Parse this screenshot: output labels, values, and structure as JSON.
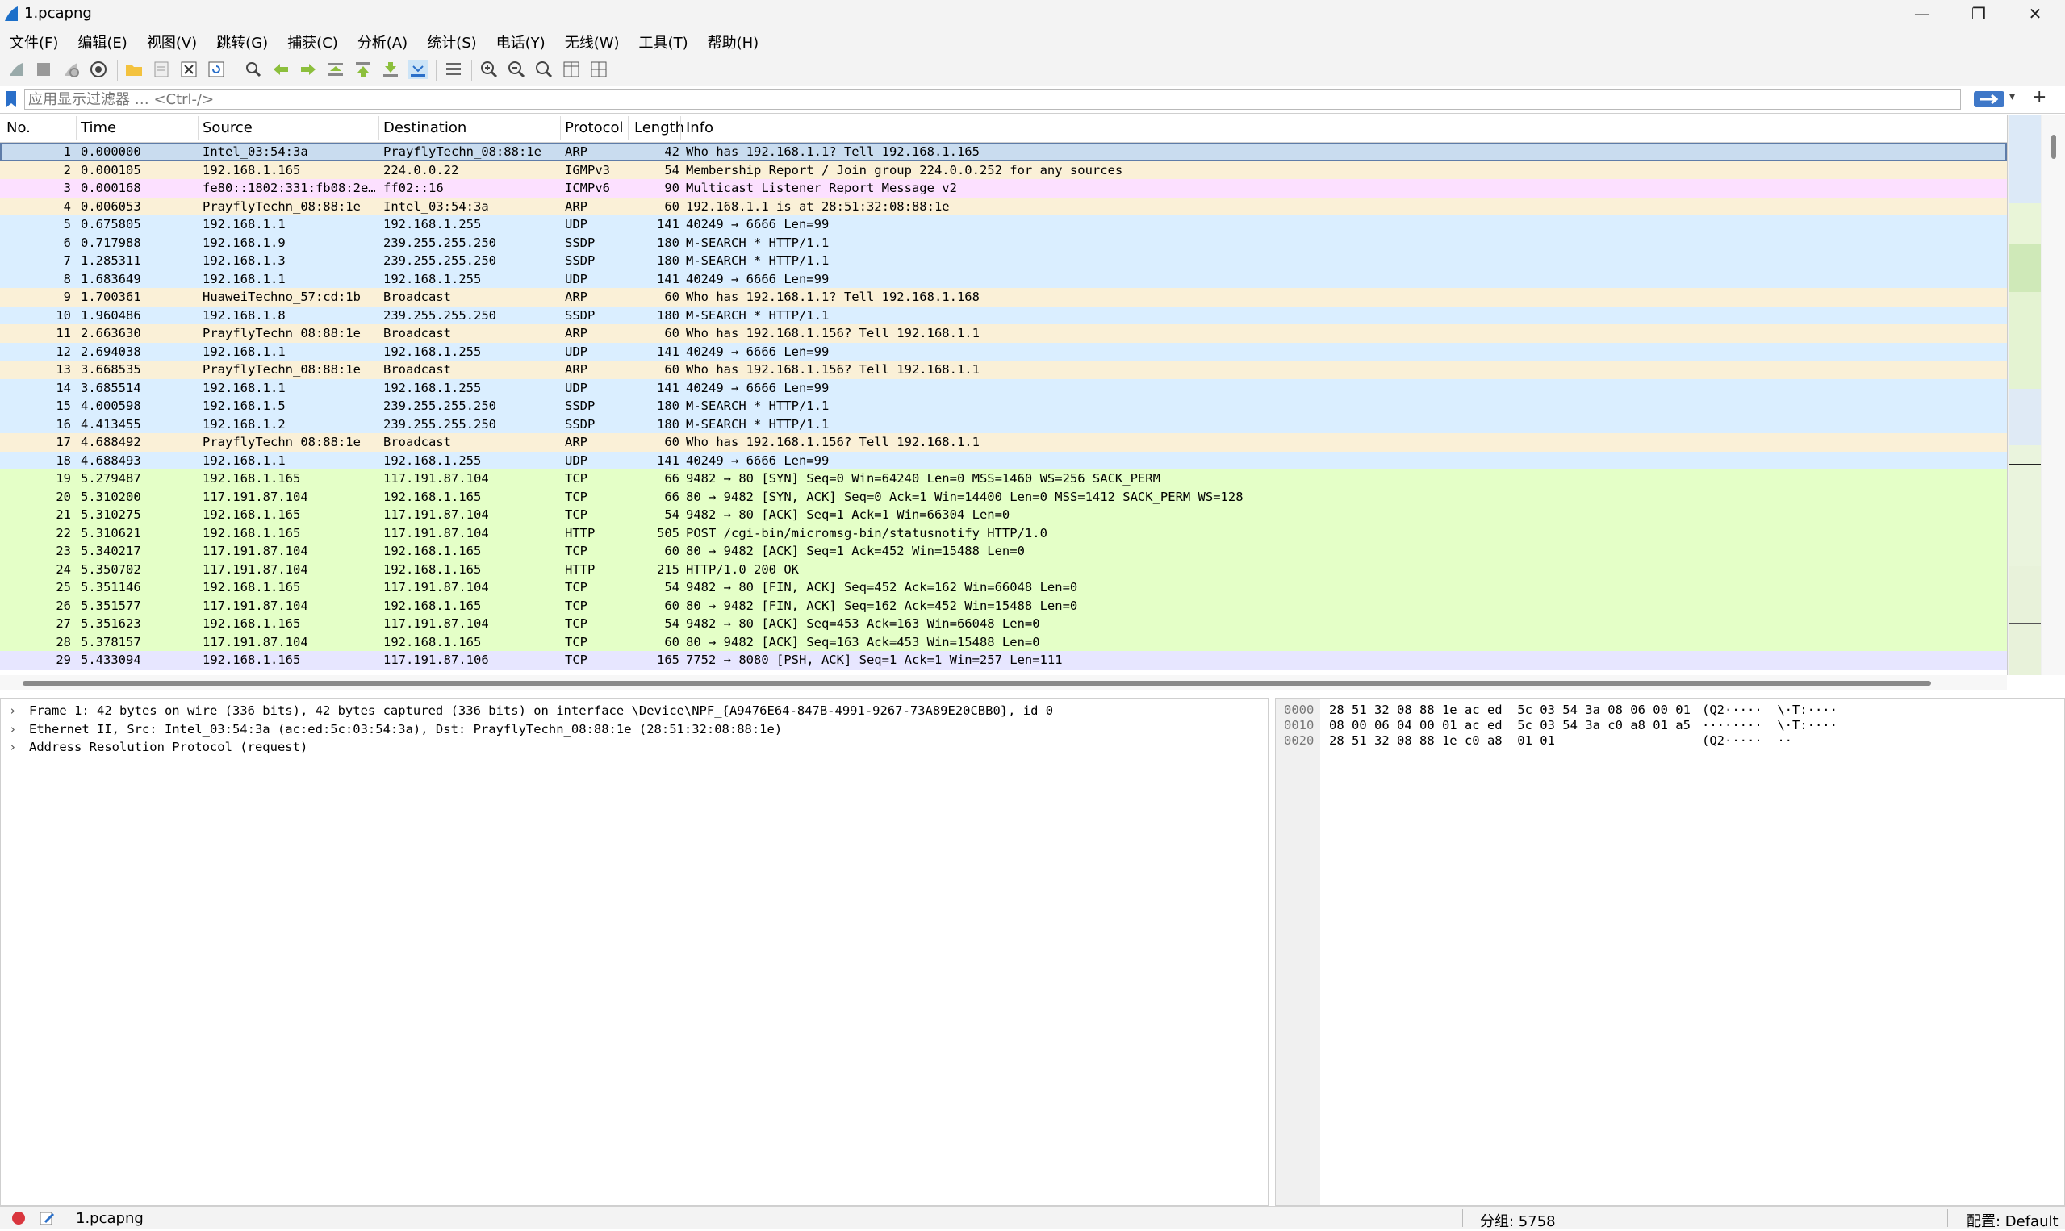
{
  "window": {
    "title": "1.pcapng"
  },
  "menu": [
    "文件(F)",
    "编辑(E)",
    "视图(V)",
    "跳转(G)",
    "捕获(C)",
    "分析(A)",
    "统计(S)",
    "电话(Y)",
    "无线(W)",
    "工具(T)",
    "帮助(H)"
  ],
  "filter": {
    "placeholder": "应用显示过滤器 … <Ctrl-/>",
    "value": ""
  },
  "columns": [
    "No.",
    "Time",
    "Source",
    "Destination",
    "Protocol",
    "Length",
    "Info"
  ],
  "colors": {
    "arp": "#faf0d7",
    "udp": "#daeeff",
    "icmpv6": "#fce0ff",
    "tcp": "#e7e6ff",
    "http": "#e4ffc7",
    "selected_border": "#5e7ca8"
  },
  "packets": [
    {
      "no": "1",
      "time": "0.000000",
      "src": "Intel_03:54:3a",
      "dst": "PrayflyTechn_08:88:1e",
      "proto": "ARP",
      "len": "42",
      "info": "Who has 192.168.1.1? Tell 192.168.1.165",
      "color": "arp-sel"
    },
    {
      "no": "2",
      "time": "0.000105",
      "src": "192.168.1.165",
      "dst": "224.0.0.22",
      "proto": "IGMPv3",
      "len": "54",
      "info": "Membership Report / Join group 224.0.0.252 for any sources",
      "color": "arp"
    },
    {
      "no": "3",
      "time": "0.000168",
      "src": "fe80::1802:331:fb08:2e…",
      "dst": "ff02::16",
      "proto": "ICMPv6",
      "len": "90",
      "info": "Multicast Listener Report Message v2",
      "color": "icmpv6"
    },
    {
      "no": "4",
      "time": "0.006053",
      "src": "PrayflyTechn_08:88:1e",
      "dst": "Intel_03:54:3a",
      "proto": "ARP",
      "len": "60",
      "info": "192.168.1.1 is at 28:51:32:08:88:1e",
      "color": "arp"
    },
    {
      "no": "5",
      "time": "0.675805",
      "src": "192.168.1.1",
      "dst": "192.168.1.255",
      "proto": "UDP",
      "len": "141",
      "info": "40249 → 6666 Len=99",
      "color": "udp"
    },
    {
      "no": "6",
      "time": "0.717988",
      "src": "192.168.1.9",
      "dst": "239.255.255.250",
      "proto": "SSDP",
      "len": "180",
      "info": "M-SEARCH * HTTP/1.1",
      "color": "udp"
    },
    {
      "no": "7",
      "time": "1.285311",
      "src": "192.168.1.3",
      "dst": "239.255.255.250",
      "proto": "SSDP",
      "len": "180",
      "info": "M-SEARCH * HTTP/1.1",
      "color": "udp"
    },
    {
      "no": "8",
      "time": "1.683649",
      "src": "192.168.1.1",
      "dst": "192.168.1.255",
      "proto": "UDP",
      "len": "141",
      "info": "40249 → 6666 Len=99",
      "color": "udp"
    },
    {
      "no": "9",
      "time": "1.700361",
      "src": "HuaweiTechno_57:cd:1b",
      "dst": "Broadcast",
      "proto": "ARP",
      "len": "60",
      "info": "Who has 192.168.1.1? Tell 192.168.1.168",
      "color": "arp"
    },
    {
      "no": "10",
      "time": "1.960486",
      "src": "192.168.1.8",
      "dst": "239.255.255.250",
      "proto": "SSDP",
      "len": "180",
      "info": "M-SEARCH * HTTP/1.1",
      "color": "udp"
    },
    {
      "no": "11",
      "time": "2.663630",
      "src": "PrayflyTechn_08:88:1e",
      "dst": "Broadcast",
      "proto": "ARP",
      "len": "60",
      "info": "Who has 192.168.1.156? Tell 192.168.1.1",
      "color": "arp"
    },
    {
      "no": "12",
      "time": "2.694038",
      "src": "192.168.1.1",
      "dst": "192.168.1.255",
      "proto": "UDP",
      "len": "141",
      "info": "40249 → 6666 Len=99",
      "color": "udp"
    },
    {
      "no": "13",
      "time": "3.668535",
      "src": "PrayflyTechn_08:88:1e",
      "dst": "Broadcast",
      "proto": "ARP",
      "len": "60",
      "info": "Who has 192.168.1.156? Tell 192.168.1.1",
      "color": "arp"
    },
    {
      "no": "14",
      "time": "3.685514",
      "src": "192.168.1.1",
      "dst": "192.168.1.255",
      "proto": "UDP",
      "len": "141",
      "info": "40249 → 6666 Len=99",
      "color": "udp"
    },
    {
      "no": "15",
      "time": "4.000598",
      "src": "192.168.1.5",
      "dst": "239.255.255.250",
      "proto": "SSDP",
      "len": "180",
      "info": "M-SEARCH * HTTP/1.1",
      "color": "udp"
    },
    {
      "no": "16",
      "time": "4.413455",
      "src": "192.168.1.2",
      "dst": "239.255.255.250",
      "proto": "SSDP",
      "len": "180",
      "info": "M-SEARCH * HTTP/1.1",
      "color": "udp"
    },
    {
      "no": "17",
      "time": "4.688492",
      "src": "PrayflyTechn_08:88:1e",
      "dst": "Broadcast",
      "proto": "ARP",
      "len": "60",
      "info": "Who has 192.168.1.156? Tell 192.168.1.1",
      "color": "arp"
    },
    {
      "no": "18",
      "time": "4.688493",
      "src": "192.168.1.1",
      "dst": "192.168.1.255",
      "proto": "UDP",
      "len": "141",
      "info": "40249 → 6666 Len=99",
      "color": "udp"
    },
    {
      "no": "19",
      "time": "5.279487",
      "src": "192.168.1.165",
      "dst": "117.191.87.104",
      "proto": "TCP",
      "len": "66",
      "info": "9482 → 80 [SYN] Seq=0 Win=64240 Len=0 MSS=1460 WS=256 SACK_PERM",
      "color": "http"
    },
    {
      "no": "20",
      "time": "5.310200",
      "src": "117.191.87.104",
      "dst": "192.168.1.165",
      "proto": "TCP",
      "len": "66",
      "info": "80 → 9482 [SYN, ACK] Seq=0 Ack=1 Win=14400 Len=0 MSS=1412 SACK_PERM WS=128",
      "color": "http"
    },
    {
      "no": "21",
      "time": "5.310275",
      "src": "192.168.1.165",
      "dst": "117.191.87.104",
      "proto": "TCP",
      "len": "54",
      "info": "9482 → 80 [ACK] Seq=1 Ack=1 Win=66304 Len=0",
      "color": "http"
    },
    {
      "no": "22",
      "time": "5.310621",
      "src": "192.168.1.165",
      "dst": "117.191.87.104",
      "proto": "HTTP",
      "len": "505",
      "info": "POST /cgi-bin/micromsg-bin/statusnotify HTTP/1.0",
      "color": "http"
    },
    {
      "no": "23",
      "time": "5.340217",
      "src": "117.191.87.104",
      "dst": "192.168.1.165",
      "proto": "TCP",
      "len": "60",
      "info": "80 → 9482 [ACK] Seq=1 Ack=452 Win=15488 Len=0",
      "color": "http"
    },
    {
      "no": "24",
      "time": "5.350702",
      "src": "117.191.87.104",
      "dst": "192.168.1.165",
      "proto": "HTTP",
      "len": "215",
      "info": "HTTP/1.0 200 OK",
      "color": "http"
    },
    {
      "no": "25",
      "time": "5.351146",
      "src": "192.168.1.165",
      "dst": "117.191.87.104",
      "proto": "TCP",
      "len": "54",
      "info": "9482 → 80 [FIN, ACK] Seq=452 Ack=162 Win=66048 Len=0",
      "color": "http"
    },
    {
      "no": "26",
      "time": "5.351577",
      "src": "117.191.87.104",
      "dst": "192.168.1.165",
      "proto": "TCP",
      "len": "60",
      "info": "80 → 9482 [FIN, ACK] Seq=162 Ack=452 Win=15488 Len=0",
      "color": "http"
    },
    {
      "no": "27",
      "time": "5.351623",
      "src": "192.168.1.165",
      "dst": "117.191.87.104",
      "proto": "TCP",
      "len": "54",
      "info": "9482 → 80 [ACK] Seq=453 Ack=163 Win=66048 Len=0",
      "color": "http"
    },
    {
      "no": "28",
      "time": "5.378157",
      "src": "117.191.87.104",
      "dst": "192.168.1.165",
      "proto": "TCP",
      "len": "60",
      "info": "80 → 9482 [ACK] Seq=163 Ack=453 Win=15488 Len=0",
      "color": "http"
    },
    {
      "no": "29",
      "time": "5.433094",
      "src": "192.168.1.165",
      "dst": "117.191.87.106",
      "proto": "TCP",
      "len": "165",
      "info": "7752 → 8080 [PSH, ACK] Seq=1 Ack=1 Win=257 Len=111",
      "color": "tcp"
    }
  ],
  "details": [
    {
      "arrow": "›",
      "text": "Frame 1: 42 bytes on wire (336 bits), 42 bytes captured (336 bits) on interface \\Device\\NPF_{A9476E64-847B-4991-9267-73A89E20CBB0}, id 0"
    },
    {
      "arrow": "›",
      "text": "Ethernet II, Src: Intel_03:54:3a (ac:ed:5c:03:54:3a), Dst: PrayflyTechn_08:88:1e (28:51:32:08:88:1e)"
    },
    {
      "arrow": "›",
      "text": "Address Resolution Protocol (request)"
    }
  ],
  "bytes": [
    {
      "offset": "0000",
      "hex": "28 51 32 08 88 1e ac ed  5c 03 54 3a 08 06 00 01",
      "ascii": "(Q2·····  \\·T:····"
    },
    {
      "offset": "0010",
      "hex": "08 00 06 04 00 01 ac ed  5c 03 54 3a c0 a8 01 a5",
      "ascii": "········  \\·T:····"
    },
    {
      "offset": "0020",
      "hex": "28 51 32 08 88 1e c0 a8  01 01",
      "ascii": "(Q2·····  ··"
    }
  ],
  "status": {
    "file": "1.pcapng",
    "packets": "分组: 5758",
    "profile": "配置: Default"
  }
}
